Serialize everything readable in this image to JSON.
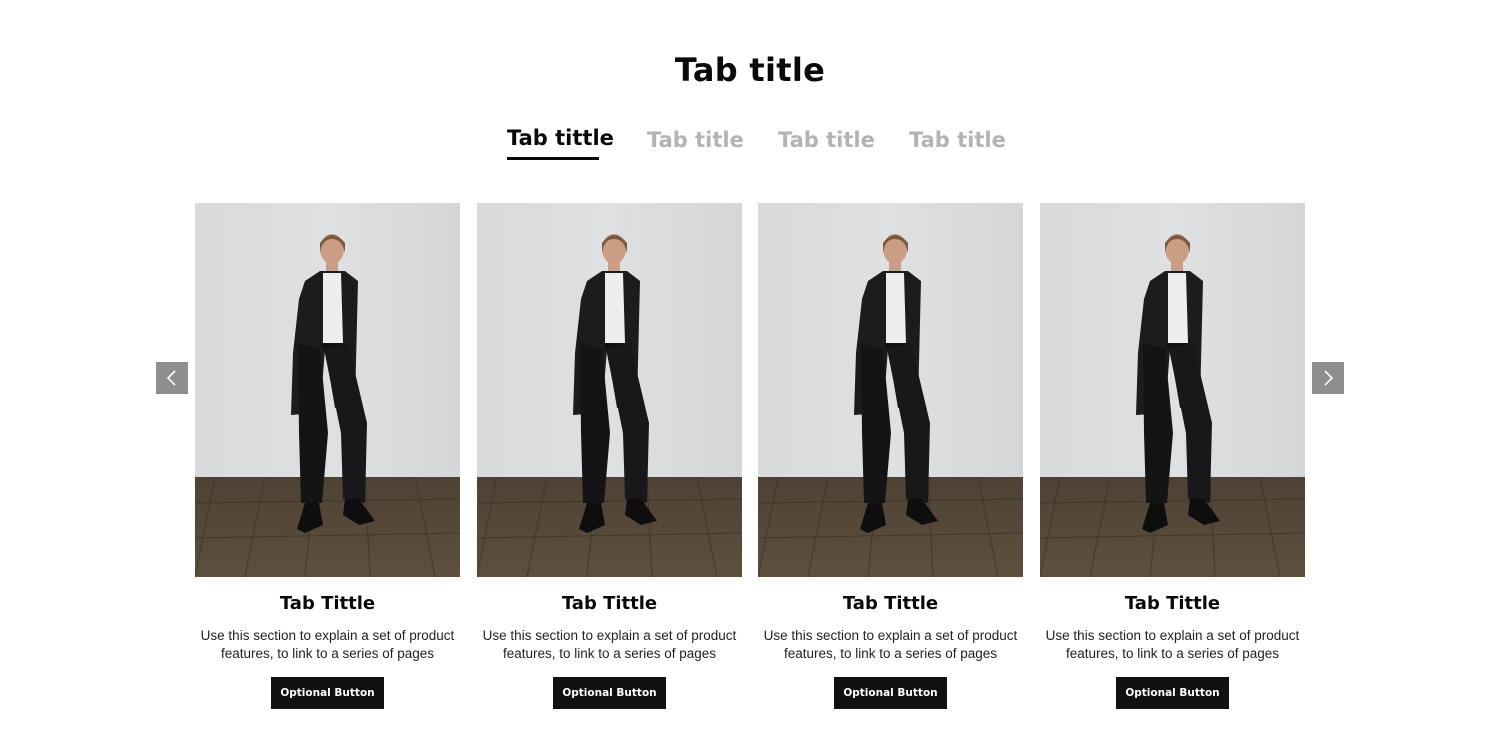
{
  "section": {
    "title": "Tab title"
  },
  "tabs": [
    {
      "label": "Tab tittle",
      "active": true
    },
    {
      "label": "Tab title",
      "active": false
    },
    {
      "label": "Tab title",
      "active": false
    },
    {
      "label": "Tab title",
      "active": false
    }
  ],
  "carousel": {
    "prev_icon": "chevron-left-icon",
    "next_icon": "chevron-right-icon",
    "arrow_color": "#8e8e8e"
  },
  "cards": [
    {
      "image": "model-in-black-suit-photo",
      "title": "Tab Tittle",
      "description": "Use this section to explain a set of product features, to link to a series of pages",
      "button_label": "Optional Button"
    },
    {
      "image": "model-in-black-suit-photo",
      "title": "Tab Tittle",
      "description": "Use this section to explain a set of product features, to link to a series of pages",
      "button_label": "Optional Button"
    },
    {
      "image": "model-in-black-suit-photo",
      "title": "Tab Tittle",
      "description": "Use this section to explain a set of product features, to link to a series of pages",
      "button_label": "Optional Button"
    },
    {
      "image": "model-in-black-suit-photo",
      "title": "Tab Tittle",
      "description": "Use this section to explain a set of product features, to link to a series of pages",
      "button_label": "Optional Button"
    }
  ],
  "colors": {
    "text": "#0a0a0a",
    "inactive_tab": "#b3b3b3",
    "button_bg": "#111111",
    "button_text": "#ffffff"
  }
}
